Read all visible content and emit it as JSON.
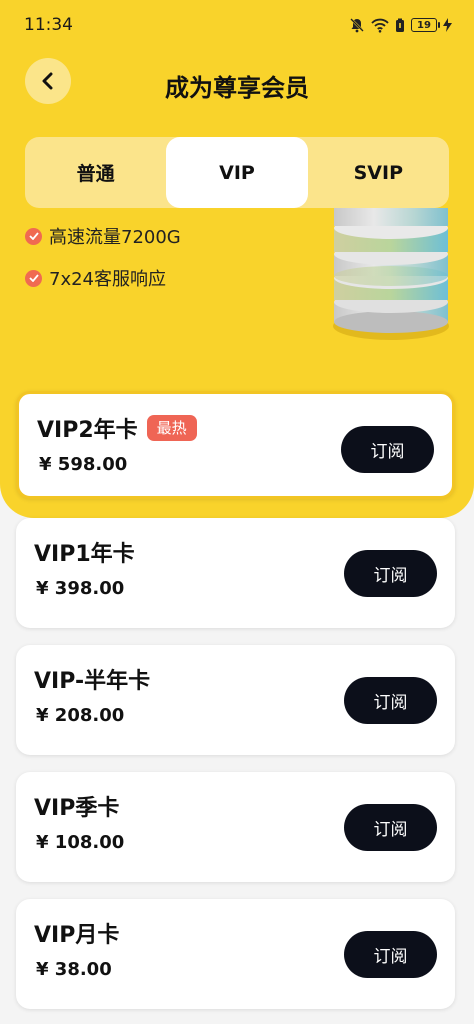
{
  "status_bar": {
    "time": "11:34",
    "battery": "19"
  },
  "header": {
    "title": "成为尊享会员"
  },
  "tabs": [
    {
      "label": "普通"
    },
    {
      "label": "VIP"
    },
    {
      "label": "SVIP"
    }
  ],
  "benefits": [
    {
      "text": "高速流量7200G"
    },
    {
      "text": "7x24客服响应"
    }
  ],
  "plans": [
    {
      "name": "VIP2年卡",
      "badge": "最热",
      "price": "¥ 598.00",
      "button": "订阅"
    },
    {
      "name": "VIP1年卡",
      "price": "¥ 398.00",
      "button": "订阅"
    },
    {
      "name": "VIP-半年卡",
      "price": "¥ 208.00",
      "button": "订阅"
    },
    {
      "name": "VIP季卡",
      "price": "¥ 108.00",
      "button": "订阅"
    },
    {
      "name": "VIP月卡",
      "price": "¥ 38.00",
      "button": "订阅"
    }
  ],
  "colors": {
    "hero": "#f9d32b",
    "accent_badge": "#ef6555",
    "button_bg": "#0c0f1a"
  },
  "icons": [
    "bell-muted-icon",
    "wifi-icon",
    "battery-saver-icon",
    "battery-icon",
    "charging-icon",
    "back-arrow-icon",
    "check-icon",
    "server-stack-illustration"
  ]
}
